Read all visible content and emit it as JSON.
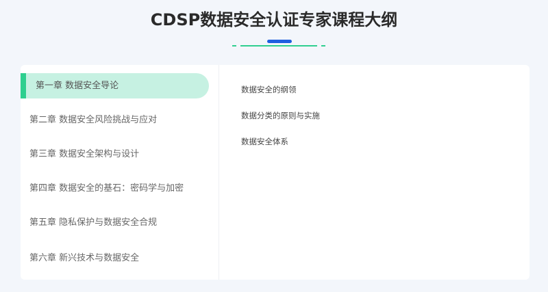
{
  "page": {
    "title": "CDSP数据安全认证专家课程大纲"
  },
  "colors": {
    "accent_blue": "#1f5fe0",
    "accent_green": "#2ecf8f",
    "active_bg": "#c6f1e2"
  },
  "chapters": [
    {
      "label": "第一章 数据安全导论",
      "active": true
    },
    {
      "label": "第二章 数据安全风险挑战与应对",
      "active": false
    },
    {
      "label": "第三章 数据安全架构与设计",
      "active": false
    },
    {
      "label": "第四章 数据安全的基石：密码学与加密",
      "active": false
    },
    {
      "label": "第五章 隐私保护与数据安全合规",
      "active": false
    },
    {
      "label": "第六章 新兴技术与数据安全",
      "active": false
    }
  ],
  "topics": [
    {
      "label": "数据安全的纲领"
    },
    {
      "label": "数据分类的原则与实施"
    },
    {
      "label": "数据安全体系"
    }
  ]
}
